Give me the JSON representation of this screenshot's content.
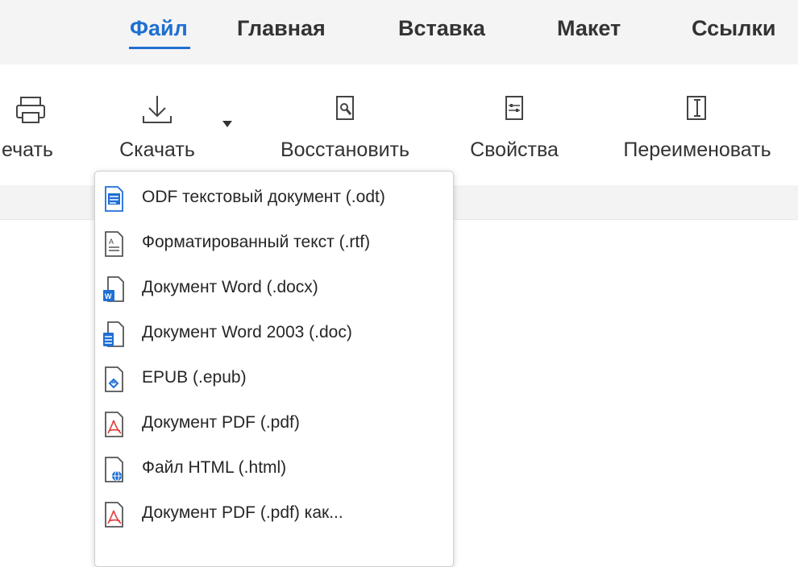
{
  "tabs": {
    "file": "Файл",
    "home": "Главная",
    "insert": "Вставка",
    "layout": "Макет",
    "references": "Ссылки"
  },
  "toolbar": {
    "print_label": "ечать",
    "download_label": "Скачать",
    "restore_label": "Восстановить",
    "properties_label": "Свойства",
    "rename_label": "Переименовать"
  },
  "download_menu": {
    "items": [
      {
        "label": "ODF текстовый документ (.odt)",
        "icon": "odt-file-icon"
      },
      {
        "label": "Форматированный текст (.rtf)",
        "icon": "rtf-file-icon"
      },
      {
        "label": "Документ Word (.docx)",
        "icon": "docx-file-icon"
      },
      {
        "label": "Документ Word 2003 (.doc)",
        "icon": "doc-file-icon"
      },
      {
        "label": "EPUB (.epub)",
        "icon": "epub-file-icon"
      },
      {
        "label": "Документ PDF (.pdf)",
        "icon": "pdf-file-icon"
      },
      {
        "label": "Файл HTML (.html)",
        "icon": "html-file-icon"
      },
      {
        "label": "Документ PDF (.pdf) как...",
        "icon": "pdf-as-file-icon"
      }
    ]
  },
  "colors": {
    "accent": "#1f6fd1",
    "tab_bar_bg": "#f4f4f4",
    "word_blue": "#1e6fd6",
    "pdf_red": "#e03b3b"
  }
}
